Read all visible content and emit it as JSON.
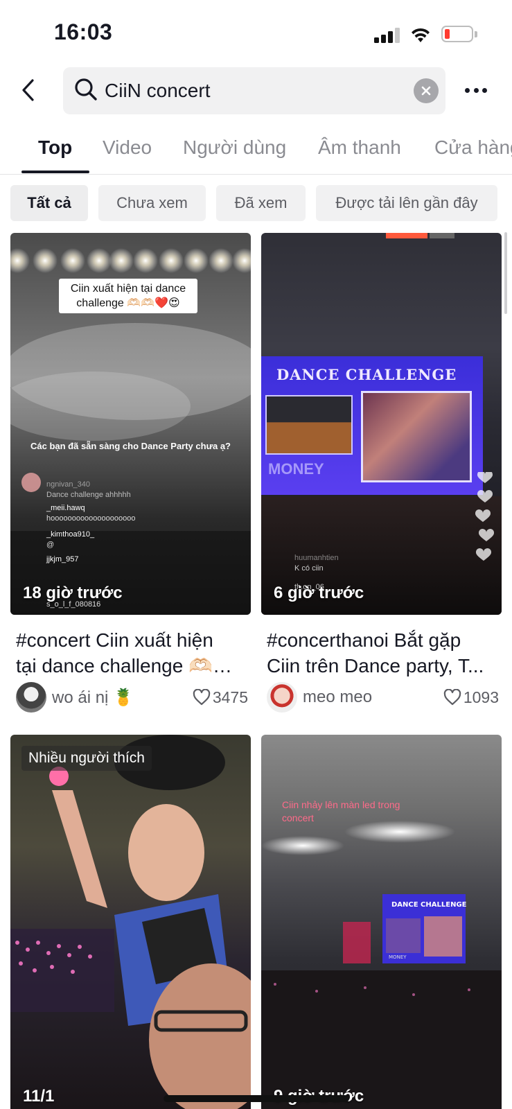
{
  "status_bar": {
    "time": "16:03",
    "battery_color": "#ff3b30"
  },
  "search": {
    "query": "CiiN concert"
  },
  "tabs": [
    {
      "label": "Top",
      "active": true
    },
    {
      "label": "Video"
    },
    {
      "label": "Người dùng"
    },
    {
      "label": "Âm thanh"
    },
    {
      "label": "Cửa hàng"
    }
  ],
  "filters": [
    {
      "label": "Tất cả",
      "active": true
    },
    {
      "label": "Chưa xem"
    },
    {
      "label": "Đã xem"
    },
    {
      "label": "Được tải lên gần đây"
    }
  ],
  "results": [
    {
      "time_overlay": "18 giờ trước",
      "caption_overlay": "Ciin xuất hiện tại dance challenge 🫶🏻🫶🏻❤️😍",
      "screen_text": "Các bạn đã sẵn sàng cho Dance Party chưa ạ?",
      "comments": [
        "ngnivan_340",
        "Dance challenge ahhhhh",
        "_meii.hawq",
        "hoooooooooooooooooooo",
        "_kimthoa910_",
        "@",
        "jjkjm_957",
        "s_o_l_f_080816"
      ],
      "title_line1": "#concert Ciin xuất hiện",
      "title_line2": "tại dance challenge 🫶🏻🫶🏻❤️😍",
      "author": "wo ái nị 🍍",
      "likes": "3475"
    },
    {
      "time_overlay": "6 giờ trước",
      "screen_text": "DANCE CHALLENGE",
      "screen_subtext": "MONEY",
      "comments": [
        "huumanhtien",
        "K có ciin",
        "th.on_06"
      ],
      "title_line1": "#concerthanoi Bắt gặp",
      "title_line2": "Ciin trên Dance party, T...",
      "author": "meo meo",
      "likes": "1093"
    },
    {
      "badge": "Nhiều người thích",
      "time_overlay": "11/1"
    },
    {
      "caption_overlay": "Ciin nhảy lên màn led trong concert",
      "screen_text": "DANCE CHALLENGE",
      "screen_subtext": "MONEY",
      "time_overlay": "9 giờ trước"
    }
  ]
}
